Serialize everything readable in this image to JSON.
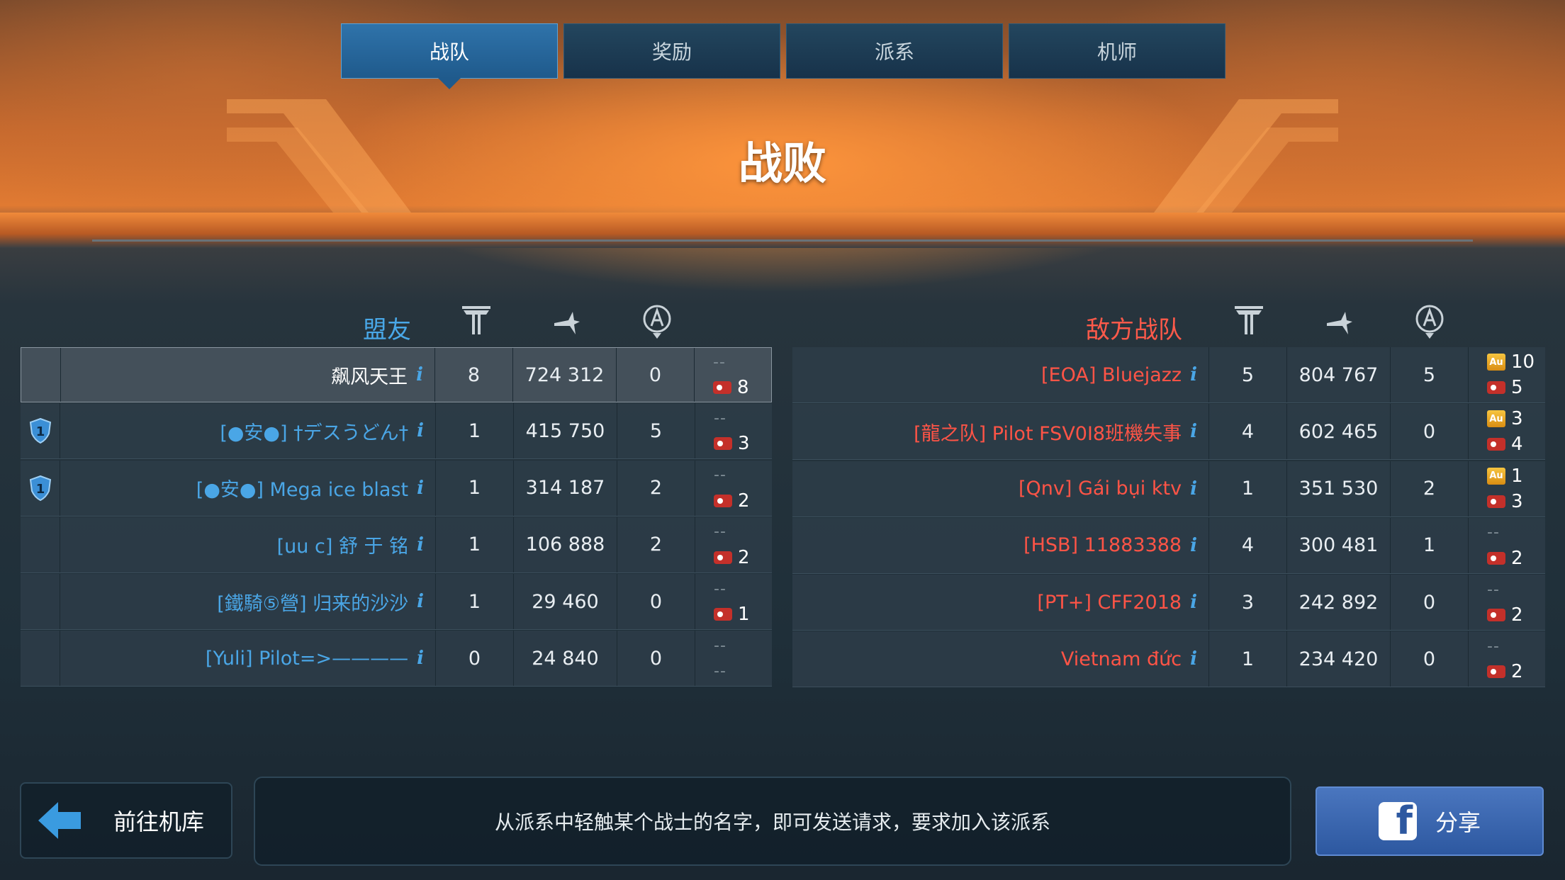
{
  "tabs": [
    {
      "label": "战队",
      "active": true
    },
    {
      "label": "奖励",
      "active": false
    },
    {
      "label": "派系",
      "active": false
    },
    {
      "label": "机师",
      "active": false
    }
  ],
  "result": "战败",
  "ally": {
    "label": "盟友",
    "rows": [
      {
        "name": "飙风天王",
        "kills": "8",
        "damage": "724 312",
        "assists": "0",
        "au": "--",
        "keys": "8",
        "shield": false,
        "self": true
      },
      {
        "name": "[●安●] †デスうどん†",
        "kills": "1",
        "damage": "415 750",
        "assists": "5",
        "au": "--",
        "keys": "3",
        "shield": true,
        "shield_num": "1"
      },
      {
        "name": "[●安●] Mega ice blast",
        "kills": "1",
        "damage": "314 187",
        "assists": "2",
        "au": "--",
        "keys": "2",
        "shield": true,
        "shield_num": "1"
      },
      {
        "name": "[uu c] 舒 于 铭",
        "kills": "1",
        "damage": "106 888",
        "assists": "2",
        "au": "--",
        "keys": "2",
        "shield": false
      },
      {
        "name": "[鐵騎⑤營] 归来的沙沙",
        "kills": "1",
        "damage": "29 460",
        "assists": "0",
        "au": "--",
        "keys": "1",
        "shield": false
      },
      {
        "name": "[Yuli] Pilot=>————",
        "kills": "0",
        "damage": "24 840",
        "assists": "0",
        "au": "--",
        "keys": "--",
        "shield": false
      }
    ]
  },
  "enemy": {
    "label": "敌方战队",
    "rows": [
      {
        "name": "[EOA] Bluejazz",
        "kills": "5",
        "damage": "804 767",
        "assists": "5",
        "au": "10",
        "keys": "5"
      },
      {
        "name": "[龍之队] Pilot FSV0I8班機失事",
        "kills": "4",
        "damage": "602 465",
        "assists": "0",
        "au": "3",
        "keys": "4"
      },
      {
        "name": "[Qnv] Gái bụi ktv",
        "kills": "1",
        "damage": "351 530",
        "assists": "2",
        "au": "1",
        "keys": "3"
      },
      {
        "name": "[HSB] 11883388",
        "kills": "4",
        "damage": "300 481",
        "assists": "1",
        "au": "--",
        "keys": "2"
      },
      {
        "name": "[PT+] CFF2018",
        "kills": "3",
        "damage": "242 892",
        "assists": "0",
        "au": "--",
        "keys": "2"
      },
      {
        "name": "Vietnam đức",
        "kills": "1",
        "damage": "234 420",
        "assists": "0",
        "au": "--",
        "keys": "2"
      }
    ]
  },
  "info_glyph": "i",
  "au_label": "Au",
  "bottom": {
    "back_label": "前往机库",
    "tip": "从派系中轻触某个战士的名字，即可发送请求，要求加入该派系",
    "share_label": "分享",
    "share_icon": "f"
  },
  "icons": [
    "kills-icon",
    "damage-icon",
    "assist-icon",
    "key-icon",
    "gold-icon",
    "shield-icon",
    "back-arrow-icon",
    "facebook-icon",
    "info-icon"
  ]
}
